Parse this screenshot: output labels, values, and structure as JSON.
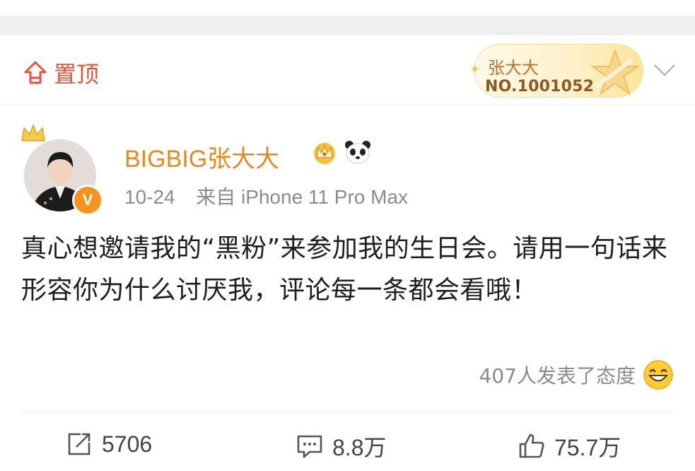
{
  "pin": {
    "label": "置顶"
  },
  "fan_badge": {
    "name": "张大大",
    "number": "NO.1001052"
  },
  "author": {
    "name": "BIGBIG张大大",
    "verified_mark": "V"
  },
  "meta": {
    "date": "10-24",
    "source": "来自 iPhone 11 Pro Max"
  },
  "post": {
    "text": "真心想邀请我的“黑粉”来参加我的生日会。请用一句话来形容你为什么讨厌我，评论每一条都会看哦！"
  },
  "attitude": {
    "label": "407人发表了态度"
  },
  "actions": {
    "repost_count": "5706",
    "comment_count": "8.8万",
    "like_count": "75.7万"
  },
  "colors": {
    "accent_red": "#e8533a",
    "username_orange": "#e8891f",
    "badge_gold": "#b8742f"
  },
  "icons": {
    "pin": "pin-top-icon",
    "star": "star-icon",
    "chevron": "chevron-down-icon",
    "crown": "crown-icon",
    "panda": "panda-icon",
    "emoji": "grin-emoji-icon",
    "repost": "repost-icon",
    "comment": "comment-icon",
    "like": "thumbs-up-icon"
  }
}
